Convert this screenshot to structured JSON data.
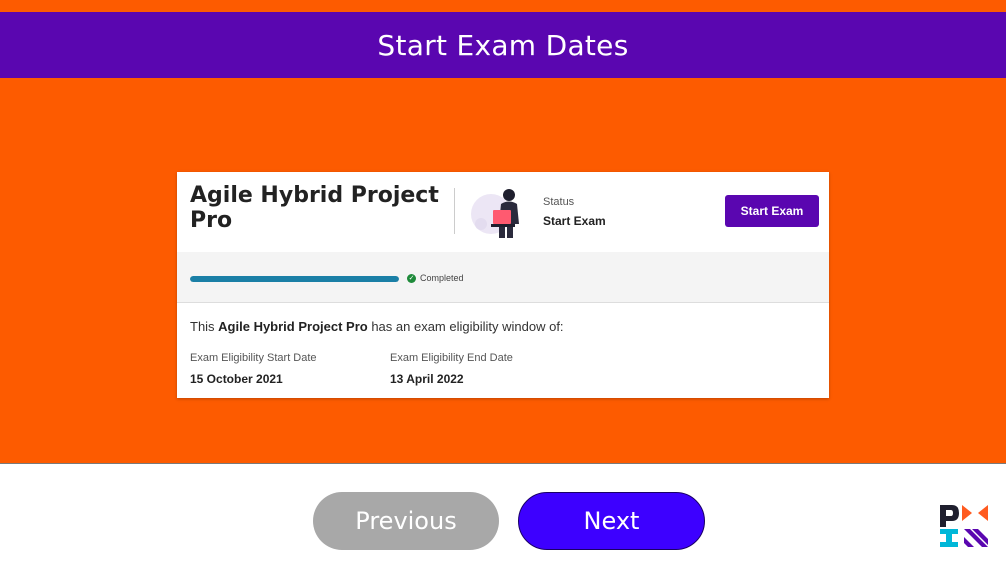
{
  "page": {
    "title": "Start Exam Dates"
  },
  "card": {
    "course_title": "Agile Hybrid Project Pro",
    "status_label": "Status",
    "status_value": "Start Exam",
    "start_exam_button": "Start Exam",
    "progress": {
      "percent": 100,
      "label": "Completed"
    },
    "eligibility": {
      "prefix": "This ",
      "course_name": "Agile Hybrid Project Pro",
      "suffix": " has an exam eligibility window of:",
      "start_label": "Exam Eligibility Start Date",
      "start_value": "15 October 2021",
      "end_label": "Exam Eligibility End Date",
      "end_value": "13 April 2022"
    }
  },
  "navigation": {
    "previous_label": "Previous",
    "next_label": "Next"
  },
  "colors": {
    "brand_purple": "#5a06b0",
    "orange": "#fd5b00",
    "next_blue": "#3d00ff",
    "progress_teal": "#1a7fa6",
    "completed_green": "#1e8a3a"
  },
  "icons": {
    "illustration": "person-at-laptop-illustration",
    "completed": "check-circle-icon",
    "logo": "pmi-logo"
  }
}
